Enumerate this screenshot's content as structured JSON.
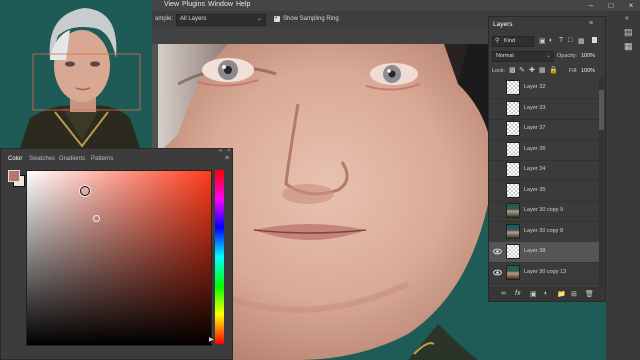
{
  "menu": {
    "items": [
      "View",
      "Plugins",
      "Window",
      "Help"
    ]
  },
  "options_bar": {
    "sample_label": "ample:",
    "sample_value": "All Layers",
    "show_ring_label": "Show Sampling Ring",
    "show_ring_checked": true
  },
  "color_panel": {
    "tabs": [
      "Color",
      "Swatches",
      "Gradients",
      "Patterns"
    ],
    "active_tab": "Color",
    "foreground_color": "#b07a6a",
    "background_color": "#f2e4dc",
    "hue_color": "#ff3b1a"
  },
  "layers_panel": {
    "title": "Layers",
    "filter_label": "Kind",
    "blend_mode": "Normal",
    "opacity_label": "Opacity:",
    "opacity_value": "100%",
    "lock_label": "Lock:",
    "fill_label": "Fill:",
    "fill_value": "100%",
    "layers": [
      {
        "name": "Layer 32",
        "visible": false,
        "thumb": "checker",
        "selected": false
      },
      {
        "name": "Layer 33",
        "visible": false,
        "thumb": "checker",
        "selected": false
      },
      {
        "name": "Layer 37",
        "visible": false,
        "thumb": "checker",
        "selected": false
      },
      {
        "name": "Layer 36",
        "visible": false,
        "thumb": "checker",
        "selected": false
      },
      {
        "name": "Layer 34",
        "visible": false,
        "thumb": "checker",
        "selected": false
      },
      {
        "name": "Layer 35",
        "visible": false,
        "thumb": "checker",
        "selected": false
      },
      {
        "name": "Layer 30 copy 9",
        "visible": false,
        "thumb": "portrait",
        "selected": false
      },
      {
        "name": "Layer 30 copy 8",
        "visible": false,
        "thumb": "portrait",
        "selected": false
      },
      {
        "name": "Layer 38",
        "visible": true,
        "thumb": "checker",
        "selected": true
      },
      {
        "name": "Layer 30 copy 13",
        "visible": true,
        "thumb": "portrait",
        "selected": false
      }
    ]
  }
}
